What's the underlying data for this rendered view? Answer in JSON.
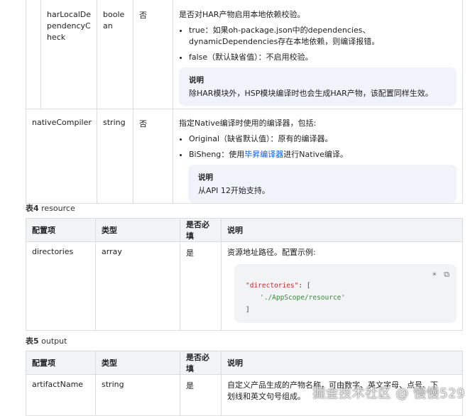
{
  "table_top": {
    "rows": [
      {
        "name": "harLocalDependencyCheck",
        "name_lines": [
          "harLocalDe",
          "pendencyC",
          "heck"
        ],
        "type_lines": [
          "boole",
          "an"
        ],
        "required": "否",
        "desc": "是否对HAR产物启用本地依赖校验。",
        "bullets": [
          "true：如果oh-package.json中的dependencies、dynamicDependencies存在本地依赖，则编译报错。",
          "false（默认缺省值）：不启用校验。"
        ],
        "note_title": "说明",
        "note_text": "除HAR模块外，HSP模块编译时也会生成HAR产物，该配置同样生效。"
      },
      {
        "name": "nativeCompiler",
        "type": "string",
        "required": "否",
        "desc": "指定Native编译时使用的编译器，包括:",
        "bullet1": "Original（缺省默认值）：原有的编译器。",
        "bullet2_pre": "BiSheng：使用",
        "bullet2_link": "毕昇编译器",
        "bullet2_post": "进行Native编译。",
        "note_title": "说明",
        "note_text": "从API 12开始支持。"
      }
    ]
  },
  "table4": {
    "caption_num": "表4",
    "caption_name": "resource",
    "headers": [
      "配置项",
      "类型",
      "是否必填",
      "说明"
    ],
    "row": {
      "name": "directories",
      "type": "array",
      "required": "是",
      "desc": "资源地址路径。配置示例:",
      "code_key": "\"directories\"",
      "code_colon": ": [",
      "code_value": "'./AppScope/resource'",
      "code_close": "]"
    }
  },
  "table5": {
    "caption_num": "表5",
    "caption_name": "output",
    "headers": [
      "配置项",
      "类型",
      "是否必填",
      "说明"
    ],
    "row": {
      "name": "artifactName",
      "type": "string",
      "required": "是",
      "desc_line1": "自定义产品生成的产物名称，可由数字、英文字母、点号、下",
      "desc_line2": "划线和英文句号组成。"
    }
  },
  "watermark": "掘金技术社区 @ 慢慢529"
}
